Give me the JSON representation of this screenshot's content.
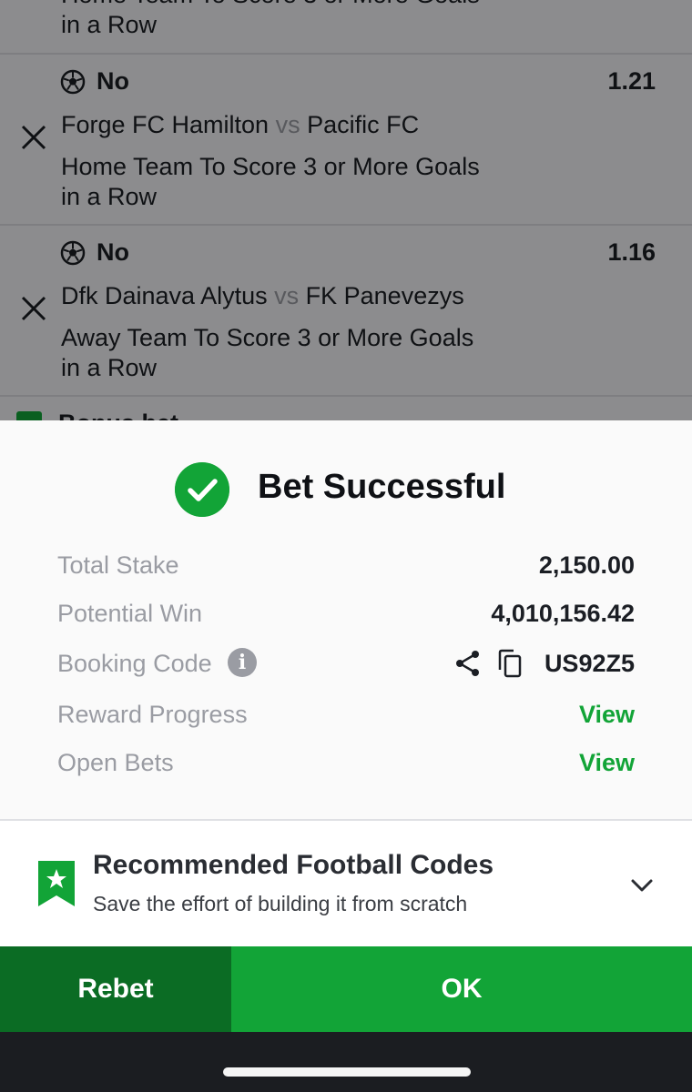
{
  "bet_slip": {
    "previous_market": "Home Team To Score 3 or More Goals in a Row",
    "selections": [
      {
        "pick": "No",
        "odds": "1.21",
        "home_team": "Forge FC Hamilton",
        "vs": "vs",
        "away_team": "Pacific FC",
        "market": "Home Team To Score 3 or More Goals in a Row"
      },
      {
        "pick": "No",
        "odds": "1.16",
        "home_team": "Dfk Dainava Alytus",
        "vs": "vs",
        "away_team": "FK Panevezys",
        "market": "Away Team To Score 3 or More Goals in a Row"
      }
    ],
    "next_item_partial": "Bonus bet"
  },
  "sheet": {
    "title": "Bet Successful",
    "total_stake_label": "Total Stake",
    "total_stake": "2,150.00",
    "potential_win_label": "Potential Win",
    "potential_win": "4,010,156.42",
    "booking_code_label": "Booking Code",
    "booking_code": "US92Z5",
    "reward_progress_label": "Reward Progress",
    "reward_progress_link": "View",
    "open_bets_label": "Open Bets",
    "open_bets_link": "View"
  },
  "recommended": {
    "title": "Recommended Football Codes",
    "subtitle": "Save the effort of building it from scratch"
  },
  "buttons": {
    "rebet": "Rebet",
    "ok": "OK"
  },
  "colors": {
    "brand_green": "#12a437",
    "dark_green": "#0b6c24",
    "muted_text": "#9a9ca3"
  }
}
